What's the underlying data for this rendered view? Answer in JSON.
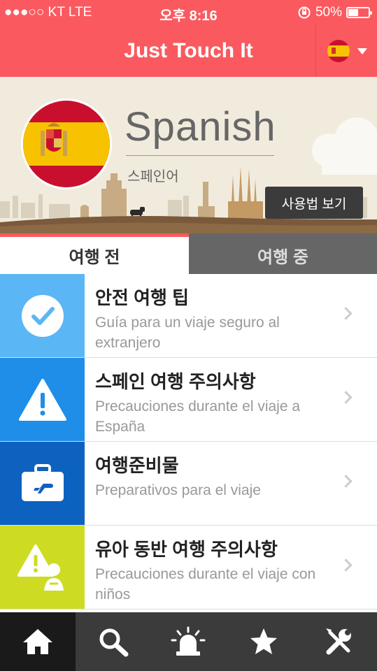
{
  "status_bar": {
    "carrier": "●●●○○ KT  LTE",
    "time": "오후 8:16",
    "battery_text": "50%",
    "battery_level": 0.5
  },
  "header": {
    "title": "Just Touch It",
    "language_flag": "spain-flag-icon"
  },
  "hero": {
    "language_name": "Spanish",
    "language_native": "스페인어",
    "howto_button": "사용법 보기"
  },
  "tabs": [
    {
      "label": "여행 전",
      "active": true
    },
    {
      "label": "여행 중",
      "active": false
    }
  ],
  "items": [
    {
      "title": "안전 여행 팁",
      "subtitle": "Guía para un viaje seguro al extranjero",
      "icon": "check-circle-icon",
      "color": "#5bb6f5"
    },
    {
      "title": "스페인 여행 주의사항",
      "subtitle": "Precauciones durante el viaje a España",
      "icon": "warning-icon",
      "color": "#1f8ee8"
    },
    {
      "title": "여행준비물",
      "subtitle": "Preparativos para el viaje",
      "icon": "suitcase-plane-icon",
      "color": "#0d62c0"
    },
    {
      "title": "유아 동반 여행 주의사항",
      "subtitle": "Precauciones durante el viaje con niños",
      "icon": "baby-warning-icon",
      "color": "#cddc23"
    }
  ],
  "bottom_nav": [
    {
      "icon": "home-icon",
      "active": true
    },
    {
      "icon": "search-icon",
      "active": false
    },
    {
      "icon": "siren-icon",
      "active": false
    },
    {
      "icon": "star-icon",
      "active": false
    },
    {
      "icon": "tools-icon",
      "active": false
    }
  ],
  "colors": {
    "brand": "#fa5a5f",
    "hero_bg": "#f1ebdd",
    "nav_bg": "#3b3b3b"
  }
}
